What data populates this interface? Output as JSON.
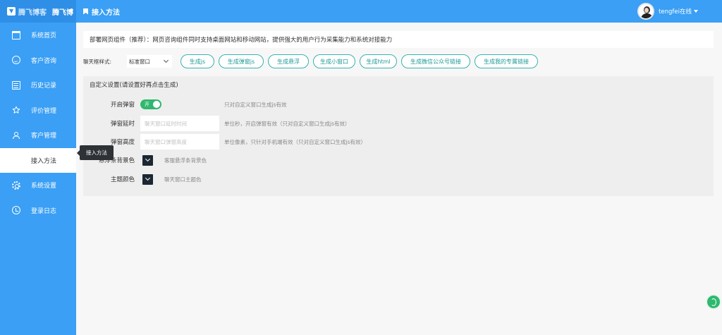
{
  "app": {
    "logo_text": "腾飞博客",
    "brand": "腾飞博",
    "page_title": "接入方法"
  },
  "user": {
    "status": "tengfei在线"
  },
  "sidebar": {
    "items": [
      {
        "label": "系统首页",
        "icon": "home-icon"
      },
      {
        "label": "客户咨询",
        "icon": "chat-icon"
      },
      {
        "label": "历史记录",
        "icon": "history-icon"
      },
      {
        "label": "评价管理",
        "icon": "star-icon"
      },
      {
        "label": "客户管理",
        "icon": "user-icon"
      },
      {
        "label": "接入方法",
        "icon": ""
      },
      {
        "label": "系统设置",
        "icon": "gear-icon"
      },
      {
        "label": "登录日志",
        "icon": "clock-icon"
      }
    ],
    "active_index": 5,
    "tooltip": "接入方法"
  },
  "main": {
    "intro": "部署网页组件（推荐）：网页咨询组件同时支持桌面网站和移动网站，提供强大的用户行为采集能力和系统对接能力",
    "style_label": "聊天框样式:",
    "style_select": "标准窗口",
    "buttons": [
      "生成js",
      "生成弹窗js",
      "生成悬浮",
      "生成小窗口",
      "生成html",
      "生成微信公众号链接",
      "生成我的专属链接"
    ],
    "custom": {
      "title": "自定义设置(请设置好再点击生成)",
      "popup_label": "开启弹窗",
      "toggle_text": "开",
      "popup_hint": "只对自定义窗口生成js有效",
      "delay_label": "弹窗延时",
      "delay_placeholder": "聊天窗口延时时间",
      "delay_hint": "单位秒，开启弹窗有效（只对自定义窗口生成js有效）",
      "height_label": "弹窗高度",
      "height_placeholder": "聊天窗口弹窗高度",
      "height_hint": "单位像素，只针对手机端有效（只对自定义窗口生成js有效）",
      "float_color_label": "悬浮条背景色",
      "float_color_hint": "客服悬浮条背景色",
      "theme_color_label": "主题颜色",
      "theme_color_hint": "聊天窗口主题色"
    }
  },
  "colors": {
    "accent": "#3a9ff5",
    "button_border": "#3ab2ad",
    "toggle_on": "#2fb86f",
    "color_swatch": "#1c2733"
  }
}
